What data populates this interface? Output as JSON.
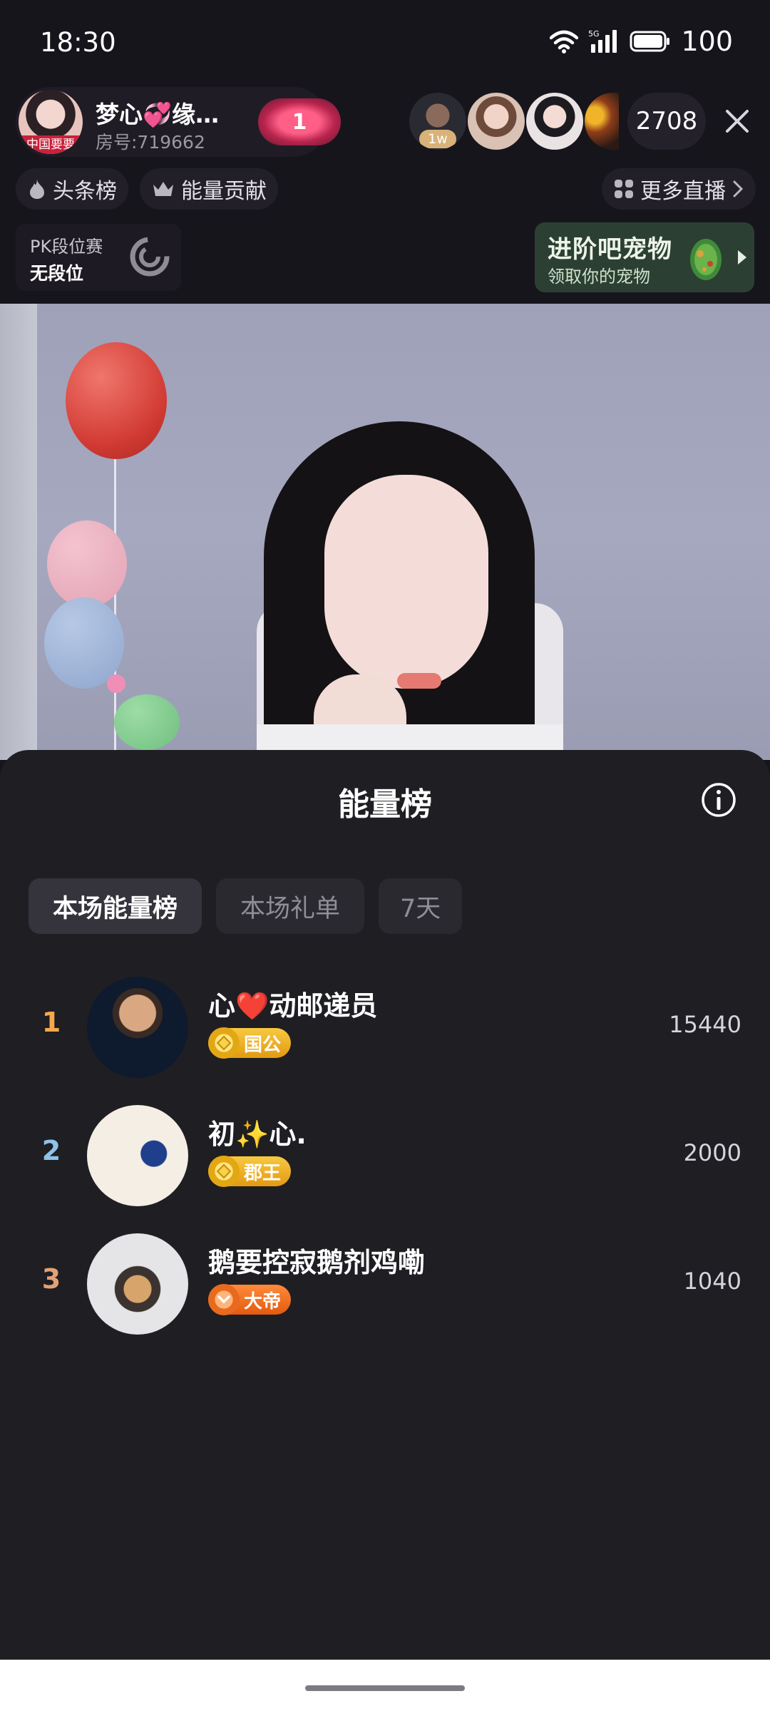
{
  "status_bar": {
    "time": "18:30",
    "battery": "100",
    "network_label": "5G"
  },
  "host": {
    "name": "梦心💞缘…",
    "room_id": "房号:719662",
    "avatar_tag": "中国要要",
    "follow_count": "1"
  },
  "viewers": {
    "top_rank_tag": "1w",
    "count": "2708"
  },
  "chips": {
    "headlines": "头条榜",
    "energy": "能量贡献",
    "more_live": "更多直播"
  },
  "pk": {
    "title": "PK段位赛",
    "rank": "无段位"
  },
  "pet_banner": {
    "title": "进阶吧宠物",
    "subtitle": "领取你的宠物"
  },
  "sheet": {
    "title": "能量榜",
    "tabs": [
      {
        "label": "本场能量榜",
        "active": true
      },
      {
        "label": "本场礼单",
        "active": false
      },
      {
        "label": "7天",
        "active": false
      }
    ],
    "entries": [
      {
        "rank": "1",
        "name": "心❤️动邮递员",
        "badge": "国公",
        "badge_style": "gold",
        "score": "15440",
        "rank_color": "#f4a94a"
      },
      {
        "rank": "2",
        "name": "初✨心.",
        "badge": "郡王",
        "badge_style": "gold",
        "score": "2000",
        "rank_color": "#8ec3e8"
      },
      {
        "rank": "3",
        "name": "鹅要控寂鹅剂鸡嘞",
        "badge": "大帝",
        "badge_style": "orange",
        "score": "1040",
        "rank_color": "#e3a177"
      }
    ]
  },
  "colors": {
    "background": "#17151c",
    "sheet": "#1f1e23",
    "tab_active": "#35343c",
    "tab_inactive": "#2a2930",
    "badge_gold": "#f0b328",
    "badge_orange": "#f07526"
  },
  "icons": [
    "wifi-icon",
    "signal-icon",
    "battery-icon",
    "close-icon",
    "flame-icon",
    "crown-icon",
    "grid-icon",
    "chevron-right-icon",
    "pk-swirl-icon",
    "egg-icon",
    "info-icon"
  ]
}
